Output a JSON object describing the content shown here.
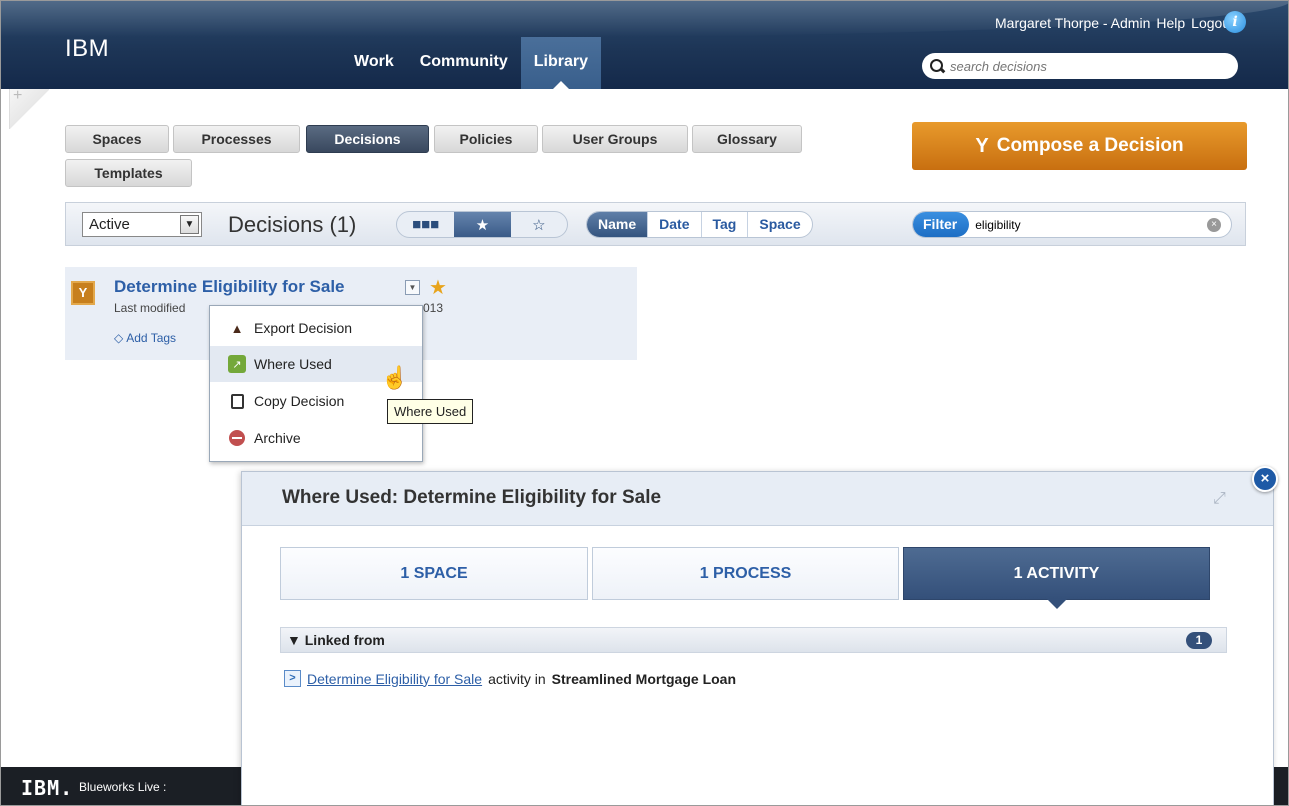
{
  "header": {
    "logo": "IBM",
    "nav": [
      "Work",
      "Community",
      "Library"
    ],
    "active_nav": "Library",
    "user": "Margaret Thorpe - Admin",
    "help": "Help",
    "logout": "Logout",
    "search_placeholder": "search decisions"
  },
  "library_tabs": [
    "Spaces",
    "Processes",
    "Decisions",
    "Policies",
    "User Groups",
    "Glossary",
    "Templates"
  ],
  "active_tab": "Decisions",
  "compose_label": "Compose a Decision",
  "toolbar": {
    "status": "Active",
    "count_label": "Decisions (1)",
    "sort_options": [
      "Name",
      "Date",
      "Tag",
      "Space"
    ],
    "active_sort": "Name",
    "filter_label": "Filter",
    "filter_value": "eligibility"
  },
  "decision": {
    "title": "Determine Eligibility for Sale",
    "meta": "Last modified",
    "meta_year_fragment": "013",
    "add_tags": "Add Tags"
  },
  "context_menu": [
    "Export Decision",
    "Where Used",
    "Copy Decision",
    "Archive"
  ],
  "tooltip": "Where Used",
  "where_used": {
    "title": "Where Used: Determine Eligibility for Sale",
    "tabs": [
      "1 SPACE",
      "1 PROCESS",
      "1 ACTIVITY"
    ],
    "active_tab": "1 ACTIVITY",
    "linked_from": "Linked from",
    "linked_count": "1",
    "link_text": "Determine Eligibility for Sale",
    "link_mid": "activity in",
    "link_target": "Streamlined Mortgage Loan"
  },
  "footer": {
    "logo": "IBM.",
    "text": "Blueworks Live :"
  },
  "colors": {
    "header_bg": "#1d3556",
    "accent_blue": "#2d5fa7",
    "compose_orange": "#d98020",
    "active_tab": "#3d4c62"
  },
  "icons": [
    "search-icon",
    "info-icon",
    "compose-icon",
    "grid-view-icon",
    "star-view-icon",
    "starred-icon",
    "clear-icon",
    "decision-icon",
    "tag-icon",
    "export-icon",
    "where-used-icon",
    "copy-icon",
    "archive-icon",
    "close-icon",
    "expand-icon",
    "activity-icon"
  ]
}
